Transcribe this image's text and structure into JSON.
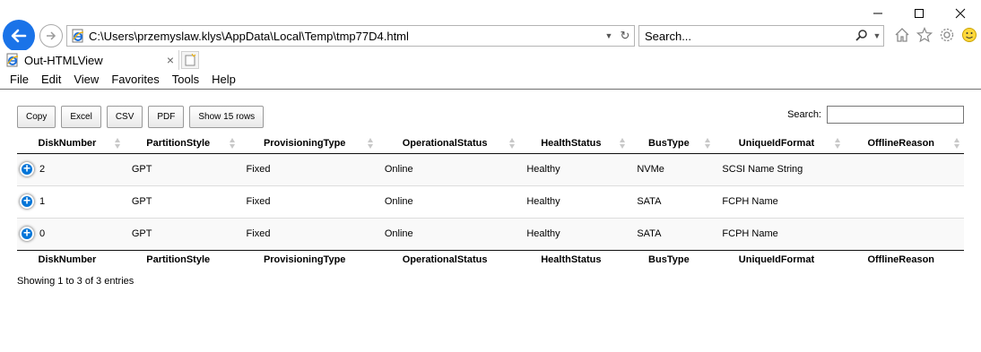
{
  "window": {
    "minimize_label": "—",
    "maximize_label": "□",
    "close_label": "✕"
  },
  "address": {
    "url": "C:\\Users\\przemyslaw.klys\\AppData\\Local\\Temp\\tmp77D4.html"
  },
  "search": {
    "placeholder": "Search..."
  },
  "tab": {
    "title": "Out-HTMLView",
    "close": "×"
  },
  "menu": [
    "File",
    "Edit",
    "View",
    "Favorites",
    "Tools",
    "Help"
  ],
  "buttons": {
    "copy": "Copy",
    "excel": "Excel",
    "csv": "CSV",
    "pdf": "PDF",
    "show_rows": "Show 15 rows"
  },
  "table_search": {
    "label": "Search:",
    "value": ""
  },
  "table": {
    "columns": [
      "DiskNumber",
      "PartitionStyle",
      "ProvisioningType",
      "OperationalStatus",
      "HealthStatus",
      "BusType",
      "UniqueIdFormat",
      "OfflineReason"
    ],
    "rows": [
      [
        "2",
        "GPT",
        "Fixed",
        "Online",
        "Healthy",
        "NVMe",
        "SCSI Name String",
        ""
      ],
      [
        "1",
        "GPT",
        "Fixed",
        "Online",
        "Healthy",
        "SATA",
        "FCPH Name",
        ""
      ],
      [
        "0",
        "GPT",
        "Fixed",
        "Online",
        "Healthy",
        "SATA",
        "FCPH Name",
        ""
      ]
    ]
  },
  "info": "Showing 1 to 3 of 3 entries",
  "colors": {
    "back_button": "#1a73e8",
    "expand_icon": "#0275d8"
  },
  "icons": [
    "back-arrow-icon",
    "forward-arrow-icon",
    "ie-page-icon",
    "dropdown-icon",
    "refresh-icon",
    "search-icon",
    "home-icon",
    "favorites-star-icon",
    "settings-gear-icon",
    "smiley-feedback-icon",
    "new-tab-icon",
    "sort-icon",
    "expand-row-icon"
  ]
}
